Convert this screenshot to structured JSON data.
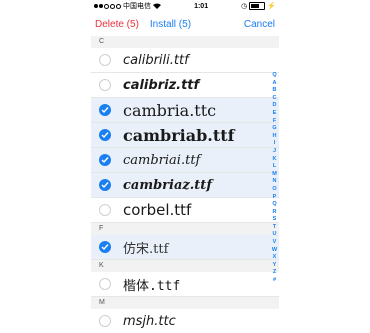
{
  "status": {
    "carrier": "中国电信",
    "time": "1:01"
  },
  "nav": {
    "delete_label": "Delete (5)",
    "install_label": "Install (5)",
    "cancel_label": "Cancel"
  },
  "sections": [
    {
      "letter": "C",
      "rows": [
        {
          "name": "calibrili.ttf",
          "selected": false
        },
        {
          "name": "calibriz.ttf",
          "selected": false
        },
        {
          "name": "cambria.ttc",
          "selected": true
        },
        {
          "name": "cambriab.ttf",
          "selected": true
        },
        {
          "name": "cambriai.ttf",
          "selected": true
        },
        {
          "name": "cambriaz.ttf",
          "selected": true
        },
        {
          "name": "corbel.ttf",
          "selected": false
        }
      ]
    },
    {
      "letter": "F",
      "rows": [
        {
          "name": "仿宋.ttf",
          "selected": true
        }
      ]
    },
    {
      "letter": "K",
      "rows": [
        {
          "name": "楷体.ttf",
          "selected": false
        }
      ]
    },
    {
      "letter": "M",
      "rows": [
        {
          "name": "msjh.ttc",
          "selected": false
        }
      ]
    }
  ],
  "index_letters": [
    "Q",
    "A",
    "B",
    "C",
    "D",
    "E",
    "F",
    "G",
    "H",
    "I",
    "J",
    "K",
    "L",
    "M",
    "N",
    "O",
    "P",
    "Q",
    "R",
    "S",
    "T",
    "U",
    "V",
    "W",
    "X",
    "Y",
    "Z",
    "#"
  ],
  "colors": {
    "accent": "#1a7ff0",
    "delete": "#e8323c",
    "selected_row": "#e9f0fa"
  }
}
